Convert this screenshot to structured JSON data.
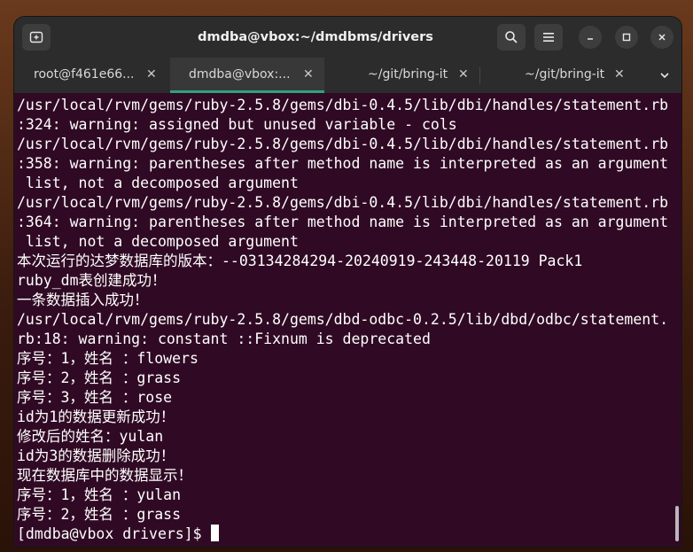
{
  "window": {
    "title": "dmdba@vbox:~/dmdbms/drivers"
  },
  "tabs": [
    {
      "label": "root@f461e66...",
      "active": false
    },
    {
      "label": "dmdba@vbox:...",
      "active": true
    },
    {
      "label": "~/git/bring-it",
      "active": false
    },
    {
      "label": "~/git/bring-it",
      "active": false
    }
  ],
  "terminal": {
    "lines": [
      "/usr/local/rvm/gems/ruby-2.5.8/gems/dbi-0.4.5/lib/dbi/handles/statement.rb",
      ":324: warning: assigned but unused variable - cols",
      "/usr/local/rvm/gems/ruby-2.5.8/gems/dbi-0.4.5/lib/dbi/handles/statement.rb",
      ":358: warning: parentheses after method name is interpreted as an argument",
      " list, not a decomposed argument",
      "/usr/local/rvm/gems/ruby-2.5.8/gems/dbi-0.4.5/lib/dbi/handles/statement.rb",
      ":364: warning: parentheses after method name is interpreted as an argument",
      " list, not a decomposed argument",
      "本次运行的达梦数据库的版本：--03134284294-20240919-243448-20119 Pack1",
      "ruby_dm表创建成功！",
      "一条数据插入成功！",
      "/usr/local/rvm/gems/ruby-2.5.8/gems/dbd-odbc-0.2.5/lib/dbd/odbc/statement.",
      "rb:18: warning: constant ::Fixnum is deprecated",
      "序号：1，姓名 ：flowers",
      "序号：2，姓名 ：grass",
      "序号：3，姓名 ：rose",
      "id为1的数据更新成功！",
      "修改后的姓名：yulan",
      "id为3的数据删除成功！",
      "现在数据库中的数据显示！",
      "序号：1，姓名 ：yulan",
      "序号：2，姓名 ：grass"
    ],
    "prompt": "[dmdba@vbox drivers]$ "
  },
  "colors": {
    "terminal_bg": "#300a24",
    "active_tab_indicator": "#2fa37a",
    "titlebar_bg": "#2c2c2c"
  },
  "icons": {
    "new_tab": "new-tab-icon",
    "search": "search-icon",
    "menu": "hamburger-menu-icon",
    "minimize": "minimize-icon",
    "maximize": "maximize-icon",
    "close": "close-icon",
    "tab_close": "close-icon",
    "tab_overflow": "chevron-down-icon"
  }
}
